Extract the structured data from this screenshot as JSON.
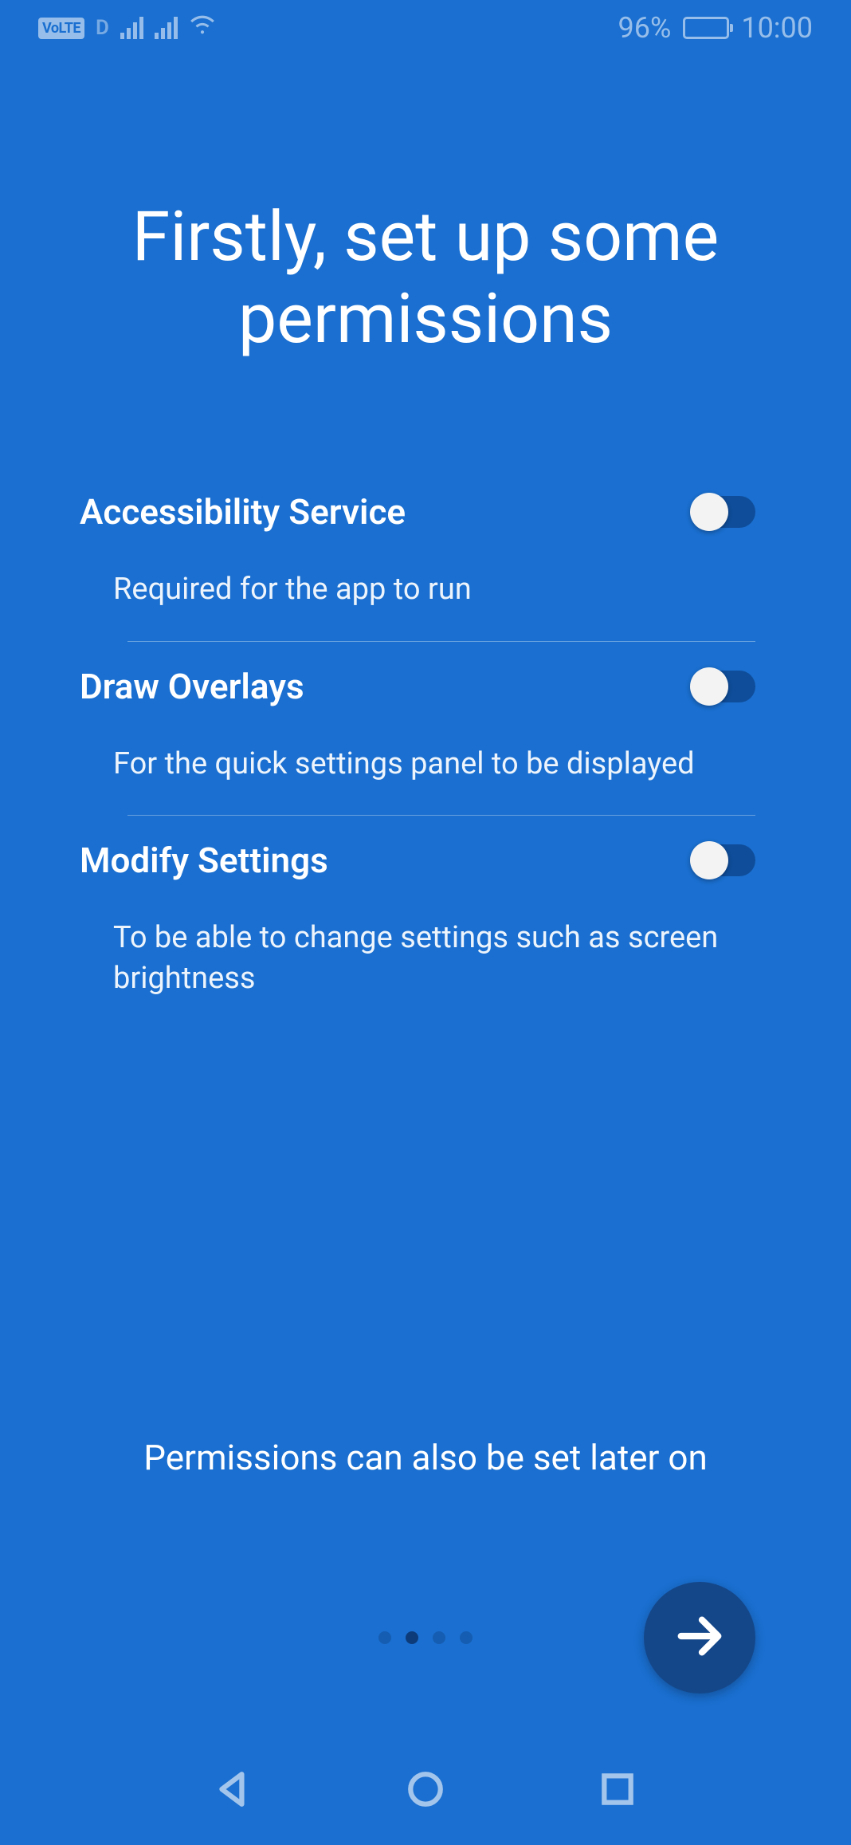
{
  "status": {
    "volte": "VoLTE",
    "sim_indicator": "D",
    "battery_percent": "96%",
    "time": "10:00"
  },
  "title": "Firstly, set up some permissions",
  "permissions": [
    {
      "name": "Accessibility Service",
      "description": "Required for the app to run",
      "enabled": false
    },
    {
      "name": "Draw Overlays",
      "description": "For the quick settings panel to be displayed",
      "enabled": false
    },
    {
      "name": "Modify Settings",
      "description": "To be able to change settings such as screen brightness",
      "enabled": false
    }
  ],
  "footer_note": "Permissions can also be set later on",
  "pager": {
    "count": 4,
    "active_index": 1
  }
}
